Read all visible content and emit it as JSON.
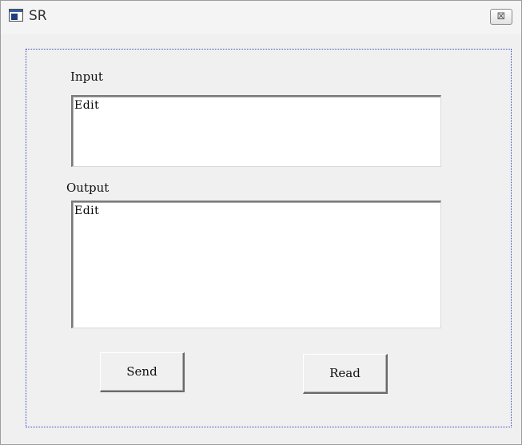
{
  "window": {
    "title": "SR",
    "close_glyph": "⊠",
    "icon": "app-window-icon",
    "close_icon": "close-icon"
  },
  "form": {
    "input_label": "Input",
    "input_value": "Edit",
    "output_label": "Output",
    "output_value": "Edit",
    "send_label": "Send",
    "read_label": "Read"
  },
  "colors": {
    "background": "#f0f0f0",
    "focus_border": "#3c4cbf",
    "edit_background": "#ffffff"
  }
}
